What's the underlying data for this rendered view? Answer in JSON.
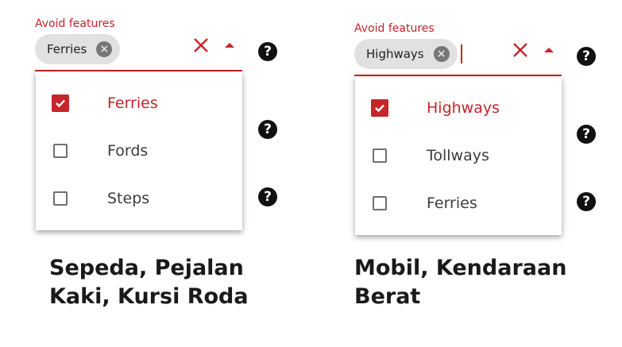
{
  "left": {
    "field_label": "Avoid features",
    "chip": {
      "label": "Ferries"
    },
    "options": [
      {
        "label": "Ferries",
        "checked": true
      },
      {
        "label": "Fords",
        "checked": false
      },
      {
        "label": "Steps",
        "checked": false
      }
    ],
    "caption_lines": [
      "Sepeda, Pejalan",
      "Kaki, Kursi Roda"
    ]
  },
  "right": {
    "field_label": "Avoid features",
    "chip": {
      "label": "Highways"
    },
    "options": [
      {
        "label": "Highways",
        "checked": true
      },
      {
        "label": "Tollways",
        "checked": false
      },
      {
        "label": "Ferries",
        "checked": false
      }
    ],
    "caption_lines": [
      "Mobil, Kendaraan",
      "Berat"
    ]
  },
  "help_glyph": "?",
  "chip_remove_glyph": "×",
  "colors": {
    "accent": "#c6252a",
    "chip_bg": "#e1e1e1",
    "help_bg": "#111111"
  }
}
